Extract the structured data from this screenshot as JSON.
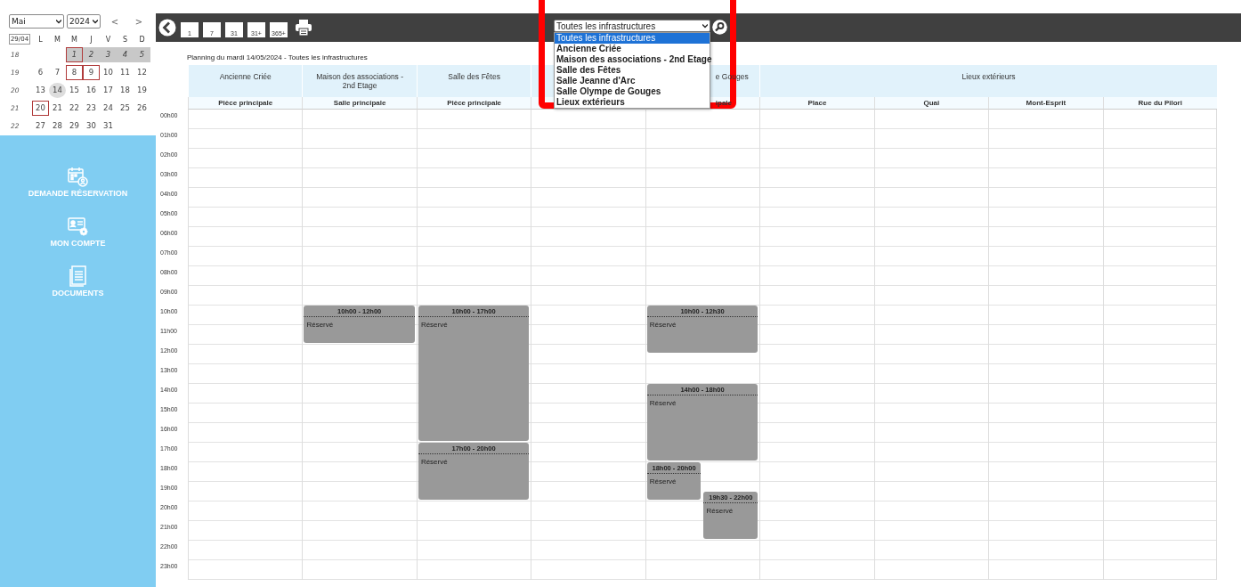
{
  "calendar": {
    "month": "Mai",
    "year": "2024",
    "prev": "<",
    "next": ">",
    "today_button": "29/04",
    "weekdays": [
      "L",
      "M",
      "M",
      "J",
      "V",
      "S",
      "D"
    ],
    "weeks": [
      {
        "number": "18",
        "days": [
          {
            "kind": "blank"
          },
          {
            "kind": "blank"
          },
          {
            "kind": "day",
            "label": "1",
            "shaded": true,
            "marked": true,
            "selected": false
          },
          {
            "kind": "day",
            "label": "2",
            "shaded": true,
            "marked": false,
            "selected": false
          },
          {
            "kind": "day",
            "label": "3",
            "shaded": true,
            "marked": false,
            "selected": false
          },
          {
            "kind": "day",
            "label": "4",
            "shaded": true,
            "marked": false,
            "selected": false
          },
          {
            "kind": "day",
            "label": "5",
            "shaded": true,
            "marked": false,
            "selected": false
          }
        ]
      },
      {
        "number": "19",
        "days": [
          {
            "kind": "day",
            "label": "6",
            "shaded": false,
            "marked": false,
            "selected": false
          },
          {
            "kind": "day",
            "label": "7",
            "shaded": false,
            "marked": false,
            "selected": false
          },
          {
            "kind": "day",
            "label": "8",
            "shaded": false,
            "marked": true,
            "selected": false
          },
          {
            "kind": "day",
            "label": "9",
            "shaded": false,
            "marked": true,
            "selected": false
          },
          {
            "kind": "day",
            "label": "10",
            "shaded": false,
            "marked": false,
            "selected": false
          },
          {
            "kind": "day",
            "label": "11",
            "shaded": false,
            "marked": false,
            "selected": false
          },
          {
            "kind": "day",
            "label": "12",
            "shaded": false,
            "marked": false,
            "selected": false
          }
        ]
      },
      {
        "number": "20",
        "days": [
          {
            "kind": "day",
            "label": "13",
            "shaded": false,
            "marked": false,
            "selected": false
          },
          {
            "kind": "day",
            "label": "14",
            "shaded": false,
            "marked": false,
            "selected": true
          },
          {
            "kind": "day",
            "label": "15",
            "shaded": false,
            "marked": false,
            "selected": false
          },
          {
            "kind": "day",
            "label": "16",
            "shaded": false,
            "marked": false,
            "selected": false
          },
          {
            "kind": "day",
            "label": "17",
            "shaded": false,
            "marked": false,
            "selected": false
          },
          {
            "kind": "day",
            "label": "18",
            "shaded": false,
            "marked": false,
            "selected": false
          },
          {
            "kind": "day",
            "label": "19",
            "shaded": false,
            "marked": false,
            "selected": false
          }
        ]
      },
      {
        "number": "21",
        "days": [
          {
            "kind": "day",
            "label": "20",
            "shaded": false,
            "marked": true,
            "selected": false
          },
          {
            "kind": "day",
            "label": "21",
            "shaded": false,
            "marked": false,
            "selected": false
          },
          {
            "kind": "day",
            "label": "22",
            "shaded": false,
            "marked": false,
            "selected": false
          },
          {
            "kind": "day",
            "label": "23",
            "shaded": false,
            "marked": false,
            "selected": false
          },
          {
            "kind": "day",
            "label": "24",
            "shaded": false,
            "marked": false,
            "selected": false
          },
          {
            "kind": "day",
            "label": "25",
            "shaded": false,
            "marked": false,
            "selected": false
          },
          {
            "kind": "day",
            "label": "26",
            "shaded": false,
            "marked": false,
            "selected": false
          }
        ]
      },
      {
        "number": "22",
        "days": [
          {
            "kind": "day",
            "label": "27",
            "shaded": false,
            "marked": false,
            "selected": false
          },
          {
            "kind": "day",
            "label": "28",
            "shaded": false,
            "marked": false,
            "selected": false
          },
          {
            "kind": "day",
            "label": "29",
            "shaded": false,
            "marked": false,
            "selected": false
          },
          {
            "kind": "day",
            "label": "30",
            "shaded": false,
            "marked": false,
            "selected": false
          },
          {
            "kind": "day",
            "label": "31",
            "shaded": false,
            "marked": false,
            "selected": false
          },
          {
            "kind": "blank"
          },
          {
            "kind": "blank"
          }
        ]
      }
    ]
  },
  "sidebar": {
    "items": [
      {
        "kind": "booking",
        "label": "DEMANDE RÉSERVATION"
      },
      {
        "kind": "account",
        "label": "MON COMPTE"
      },
      {
        "kind": "documents",
        "label": "DOCUMENTS"
      }
    ]
  },
  "toolbar": {
    "views": [
      "1",
      "7",
      "31",
      "31+",
      "365+"
    ],
    "filter": {
      "value": "Toutes les infrastructures",
      "expanded": true,
      "options": [
        {
          "label": "Toutes les infrastructures",
          "selected": true
        },
        {
          "label": "Ancienne Criée",
          "selected": false
        },
        {
          "label": "Maison des associations - 2nd Etage",
          "selected": false
        },
        {
          "label": "Salle des Fêtes",
          "selected": false
        },
        {
          "label": "Salle Jeanne d'Arc",
          "selected": false
        },
        {
          "label": "Salle Olympe de Gouges",
          "selected": false
        },
        {
          "label": "Lieux extérieurs",
          "selected": false
        }
      ]
    }
  },
  "planning": {
    "title": "Planning du mardi 14/05/2024 - Toutes les infrastructures",
    "hours": [
      "00h00",
      "01h00",
      "02h00",
      "03h00",
      "04h00",
      "05h00",
      "06h00",
      "07h00",
      "08h00",
      "09h00",
      "10h00",
      "11h00",
      "12h00",
      "13h00",
      "14h00",
      "15h00",
      "16h00",
      "17h00",
      "18h00",
      "19h00",
      "20h00",
      "21h00",
      "22h00",
      "23h00"
    ],
    "groups": [
      {
        "label": "Ancienne Criée",
        "clipped_left": false,
        "rooms": [
          {
            "kind": "room",
            "name": "Pièce principale",
            "clipped_left": false
          }
        ]
      },
      {
        "label": "Maison des associations - 2nd Etage",
        "clipped_left": false,
        "rooms": [
          {
            "kind": "room",
            "name": "Salle principale",
            "clipped_left": false,
            "bookings": [
              {
                "time": "10h00 - 12h00",
                "text": "Réservé"
              }
            ]
          }
        ]
      },
      {
        "label": "Salle des Fêtes",
        "clipped_left": false,
        "rooms": [
          {
            "kind": "room",
            "name": "Pièce principale",
            "clipped_left": false,
            "bookings": [
              {
                "time": "10h00 - 17h00",
                "text": "Réservé"
              },
              {
                "time": "17h00 - 20h00",
                "text": "Réservé"
              }
            ]
          }
        ]
      },
      {
        "rooms": [
          {
            "kind": "hidden"
          }
        ]
      },
      {
        "label": "e Gouges",
        "clipped_left": true,
        "rooms": [
          {
            "kind": "room",
            "name": "ipale",
            "clipped_left": true,
            "bookings": [
              {
                "time": "10h00 - 12h30",
                "text": "Réservé"
              },
              {
                "time": "14h00 - 18h00",
                "text": "Réservé"
              },
              {
                "time": "18h00 - 20h00",
                "text": "Réservé"
              },
              {
                "time": "19h30 - 22h00",
                "text": "Réservé"
              }
            ]
          }
        ]
      },
      {
        "label": "Lieux extérieurs",
        "clipped_left": false,
        "rooms": [
          {
            "kind": "room",
            "name": "Place",
            "clipped_left": false
          },
          {
            "kind": "room",
            "name": "Quai",
            "clipped_left": false
          },
          {
            "kind": "room",
            "name": "Mont-Esprit",
            "clipped_left": false
          },
          {
            "kind": "room",
            "name": "Rue du Pilori",
            "clipped_left": false
          }
        ]
      }
    ]
  }
}
